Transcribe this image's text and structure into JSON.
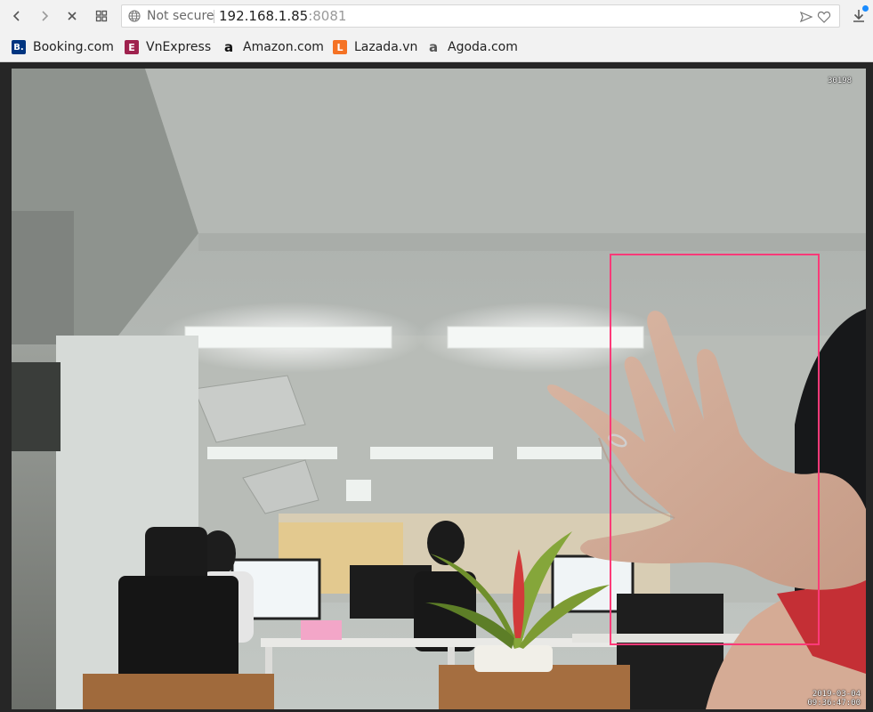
{
  "browser": {
    "security_label": "Not secure",
    "url_host": "192.168.1.85",
    "url_port": ":8081"
  },
  "bookmarks": [
    {
      "label": "Booking.com",
      "icon": "booking-icon",
      "color": "#003580",
      "glyph": "B."
    },
    {
      "label": "VnExpress",
      "icon": "vnexpress-icon",
      "color": "#9f224e",
      "glyph": "E"
    },
    {
      "label": "Amazon.com",
      "icon": "amazon-icon",
      "color": "#111111",
      "glyph": "a"
    },
    {
      "label": "Lazada.vn",
      "icon": "lazada-icon",
      "color": "#f57224",
      "glyph": "L"
    },
    {
      "label": "Agoda.com",
      "icon": "agoda-icon",
      "color": "#555555",
      "glyph": "a"
    }
  ],
  "stream": {
    "frame_counter": "30198",
    "date": "2019-03-04",
    "time": "09:36:47:00",
    "detection_color": "#ff3a78"
  }
}
